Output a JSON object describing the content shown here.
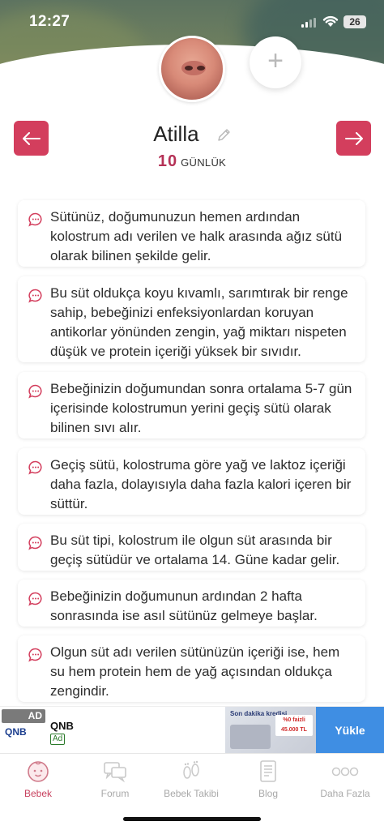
{
  "status_bar": {
    "time": "12:27",
    "battery": "26"
  },
  "profile": {
    "name": "Atilla",
    "age_value": "10",
    "age_unit": "GÜNLÜK",
    "add_symbol": "+"
  },
  "cards": [
    {
      "text": "Sütünüz, doğumunuzun hemen ardından kolostrum adı verilen ve halk arasında ağız sütü olarak bilinen şekilde gelir."
    },
    {
      "text": "Bu süt oldukça koyu kıvamlı, sarımtırak bir renge sahip, bebeğinizi enfeksiyonlardan koruyan antikorlar yönünden zengin, yağ miktarı nispeten düşük ve protein içeriği yüksek bir sıvıdır."
    },
    {
      "text": "Bebeğinizin doğumundan sonra ortalama 5-7 gün içerisinde kolostrumun yerini geçiş sütü olarak bilinen sıvı alır."
    },
    {
      "text": "Geçiş sütü, kolostruma göre yağ ve laktoz içeriği daha fazla, dolayısıyla daha fazla kalori içeren bir süttür."
    },
    {
      "text": "Bu süt tipi, kolostrum ile olgun süt arasında bir geçiş sütüdür ve ortalama 14. Güne kadar gelir."
    },
    {
      "text": "Bebeğinizin doğumunun ardından 2 hafta sonrasında ise asıl sütünüz gelmeye başlar."
    },
    {
      "text": "Olgun süt adı verilen sütünüzün içeriği ise, hem su hem protein hem de yağ açısından oldukça zengindir."
    }
  ],
  "ad": {
    "badge": "AD",
    "logo_text": "QNB",
    "brand": "QNB",
    "tag": "Ad",
    "banner_line1": "Son dakika kredisi",
    "banner_offer": "%0 faizli 45.000 TL",
    "cta": "Yükle"
  },
  "tabs": [
    {
      "label": "Bebek",
      "icon": "baby-face-icon",
      "active": true
    },
    {
      "label": "Forum",
      "icon": "chat-bubbles-icon",
      "active": false
    },
    {
      "label": "Bebek Takibi",
      "icon": "footprints-icon",
      "active": false
    },
    {
      "label": "Blog",
      "icon": "document-icon",
      "active": false
    },
    {
      "label": "Daha Fazla",
      "icon": "more-dots-icon",
      "active": false
    }
  ],
  "colors": {
    "accent": "#d33e5d",
    "active_tab": "#c8425f",
    "cta": "#3f8ee3"
  }
}
